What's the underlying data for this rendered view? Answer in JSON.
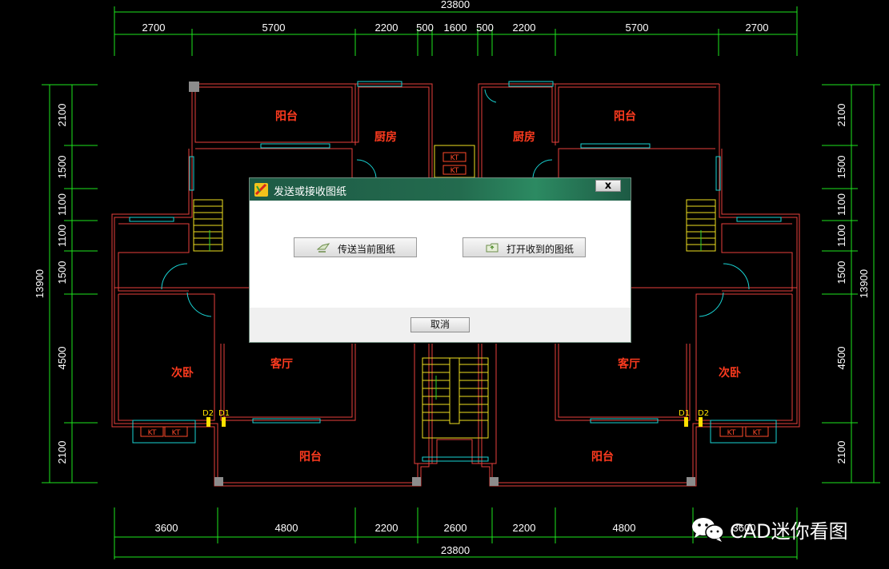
{
  "drawing": {
    "top_dims": {
      "total": "23800",
      "segments": [
        "2700",
        "5700",
        "2200",
        "500",
        "1600",
        "500",
        "2200",
        "5700",
        "2700"
      ]
    },
    "bottom_dims": {
      "total": "23800",
      "segments": [
        "3600",
        "4800",
        "2200",
        "2600",
        "2200",
        "4800",
        "3600"
      ]
    },
    "left_dims": {
      "total": "13900",
      "segments": [
        "2100",
        "1500",
        "1100",
        "1100",
        "1500",
        "4500",
        "2100"
      ]
    },
    "right_dims": {
      "total": "13900",
      "segments": [
        "2100",
        "1500",
        "1100",
        "1100",
        "1500",
        "4500",
        "2100"
      ]
    },
    "rooms": {
      "balcony": "阳台",
      "kitchen": "厨房",
      "living": "客厅",
      "bedroom": "次卧"
    },
    "tags": {
      "d1": "D1",
      "d2": "D2",
      "kt": "KT"
    }
  },
  "dialog": {
    "title": "发送或接收图纸",
    "close_label": "x",
    "send_label": "传送当前图纸",
    "open_label": "打开收到的图纸",
    "cancel_label": "取消"
  },
  "watermark": {
    "text": "CAD迷你看图"
  }
}
